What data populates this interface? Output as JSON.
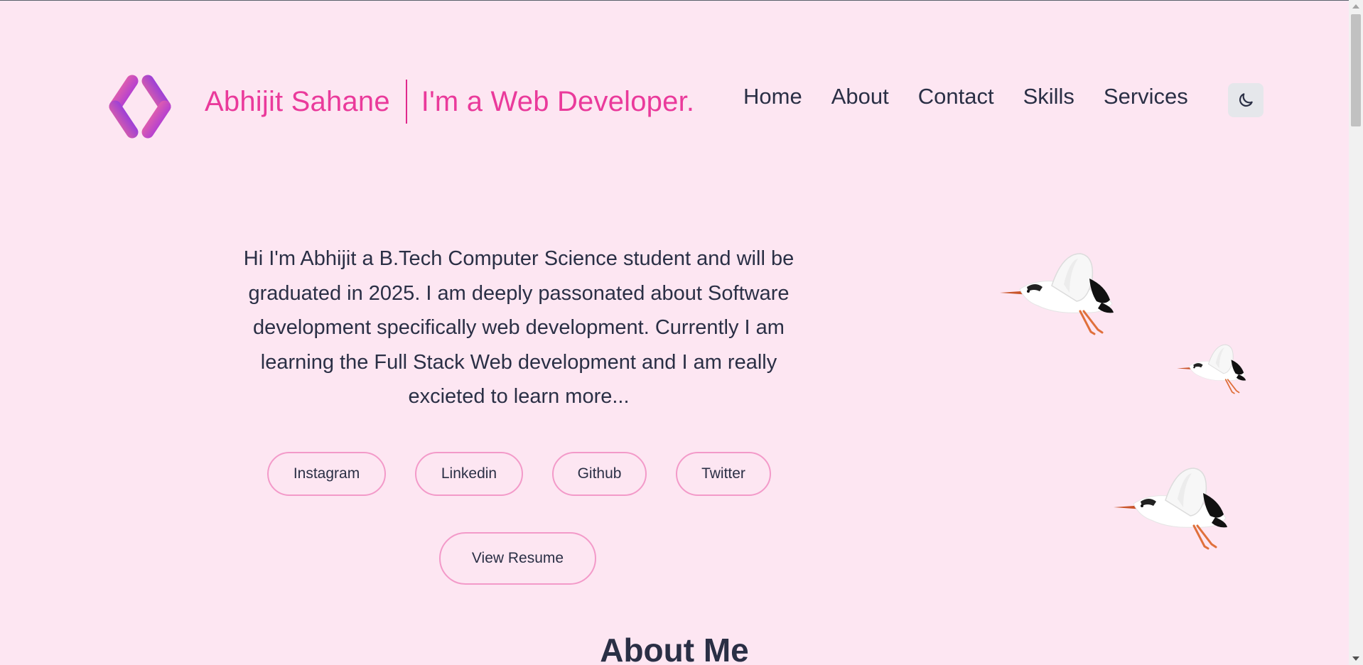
{
  "header": {
    "brand_name": "Abhijit Sahane",
    "brand_role": "I'm a Web Developer.",
    "logo_icon": "code-brackets-logo-icon",
    "nav": [
      {
        "label": "Home"
      },
      {
        "label": "About"
      },
      {
        "label": "Contact"
      },
      {
        "label": "Skills"
      },
      {
        "label": "Services"
      }
    ],
    "theme_toggle_icon": "moon-icon"
  },
  "hero": {
    "intro_lines": [
      "Hi I'm Abhijit a B.Tech Computer Science student and will be",
      "graduated in 2025. I am deeply passonated about Software",
      "development specifically web development. Currently I am",
      "learning the Full Stack Web development and I am really",
      "excieted to learn more..."
    ],
    "social_links": [
      {
        "label": "Instagram"
      },
      {
        "label": "Linkedin"
      },
      {
        "label": "Github"
      },
      {
        "label": "Twitter"
      }
    ],
    "resume_label": "View Resume",
    "illustration": "flying-storks-illustration"
  },
  "about": {
    "title": "About Me"
  },
  "colors": {
    "background": "#fde6f2",
    "brand_pink": "#ea3a9b",
    "text": "#2a2f45",
    "pill_border": "#f39ac9",
    "logo_gradient_start": "#f0548f",
    "logo_gradient_end": "#8a2be2"
  }
}
